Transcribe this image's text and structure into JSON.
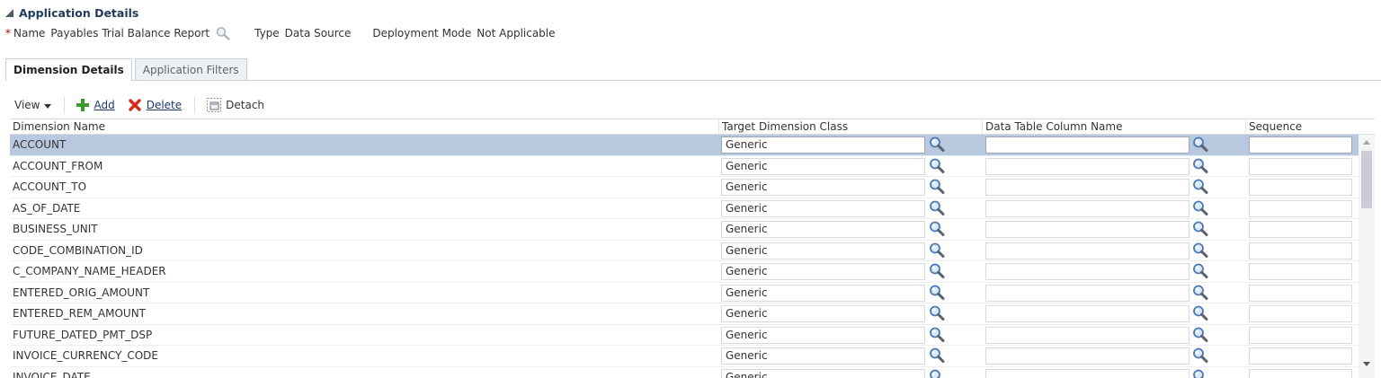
{
  "header": {
    "title": "Application Details",
    "name_label": "Name",
    "name_value": "Payables Trial Balance Report",
    "type_label": "Type",
    "type_value": "Data Source",
    "deployment_label": "Deployment Mode",
    "deployment_value": "Not Applicable"
  },
  "tabs": [
    {
      "label": "Dimension Details",
      "active": true
    },
    {
      "label": "Application Filters",
      "active": false
    }
  ],
  "toolbar": {
    "view_label": "View",
    "add_label": "Add",
    "delete_label": "Delete",
    "detach_label": "Detach"
  },
  "table": {
    "columns": [
      "Dimension Name",
      "Target Dimension Class",
      "Data Table Column Name",
      "Sequence"
    ],
    "rows": [
      {
        "name": "ACCOUNT",
        "target_class": "Generic",
        "column_name": "",
        "sequence": "",
        "selected": true
      },
      {
        "name": "ACCOUNT_FROM",
        "target_class": "Generic",
        "column_name": "",
        "sequence": ""
      },
      {
        "name": "ACCOUNT_TO",
        "target_class": "Generic",
        "column_name": "",
        "sequence": ""
      },
      {
        "name": "AS_OF_DATE",
        "target_class": "Generic",
        "column_name": "",
        "sequence": ""
      },
      {
        "name": "BUSINESS_UNIT",
        "target_class": "Generic",
        "column_name": "",
        "sequence": ""
      },
      {
        "name": "CODE_COMBINATION_ID",
        "target_class": "Generic",
        "column_name": "",
        "sequence": ""
      },
      {
        "name": "C_COMPANY_NAME_HEADER",
        "target_class": "Generic",
        "column_name": "",
        "sequence": ""
      },
      {
        "name": "ENTERED_ORIG_AMOUNT",
        "target_class": "Generic",
        "column_name": "",
        "sequence": ""
      },
      {
        "name": "ENTERED_REM_AMOUNT",
        "target_class": "Generic",
        "column_name": "",
        "sequence": ""
      },
      {
        "name": "FUTURE_DATED_PMT_DSP",
        "target_class": "Generic",
        "column_name": "",
        "sequence": ""
      },
      {
        "name": "INVOICE_CURRENCY_CODE",
        "target_class": "Generic",
        "column_name": "",
        "sequence": ""
      },
      {
        "name": "INVOICE_DATE",
        "target_class": "Generic",
        "column_name": "",
        "sequence": ""
      }
    ]
  },
  "colors": {
    "selected_row": "#b8c9df",
    "add_icon": "#3a9a2a",
    "delete_icon": "#d6281c",
    "link": "#1a3a6b"
  }
}
